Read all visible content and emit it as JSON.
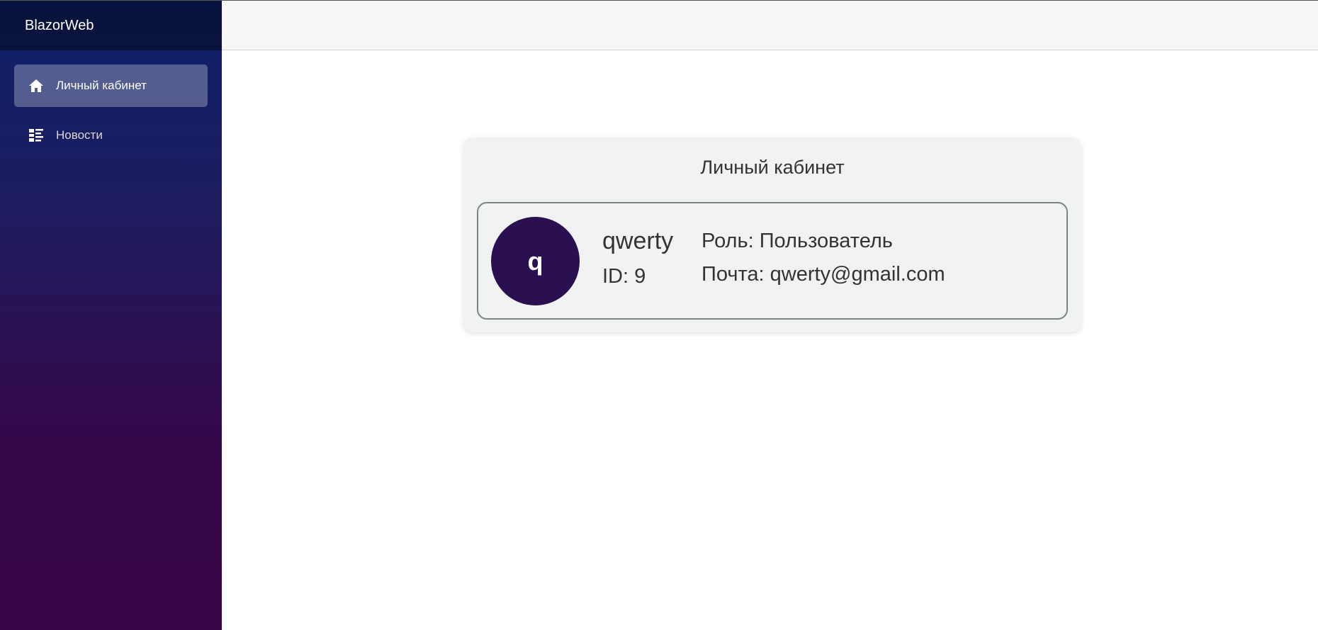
{
  "sidebar": {
    "brand": "BlazorWeb",
    "items": [
      {
        "label": "Личный кабинет",
        "icon": "home-icon",
        "active": true
      },
      {
        "label": "Новости",
        "icon": "list-icon",
        "active": false
      }
    ]
  },
  "profile_card": {
    "title": "Личный кабинет",
    "avatar_letter": "q",
    "avatar_color": "#2a1050",
    "username": "qwerty",
    "id_text": "ID: 9",
    "role_text": "Роль: Пользователь",
    "email_text": "Почта: qwerty@gmail.com"
  }
}
